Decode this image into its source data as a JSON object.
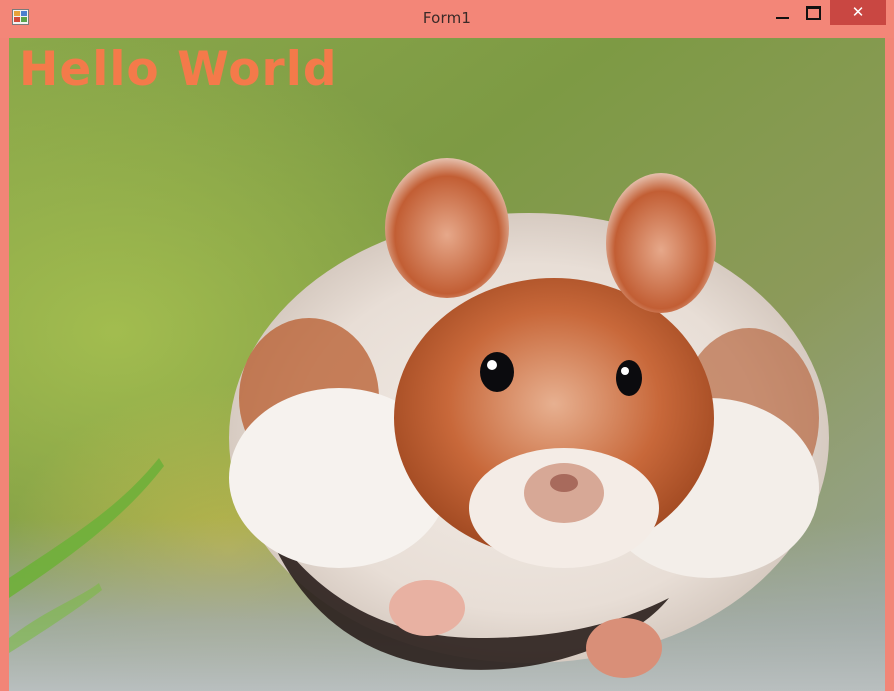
{
  "window": {
    "title": "Form1",
    "icon": "windows-forms-app-icon",
    "controls": {
      "minimize": "minimize-icon",
      "maximize": "maximize-icon",
      "close_glyph": "✕"
    },
    "frame_color": "#f38678",
    "close_color": "#c94742"
  },
  "content": {
    "label_text": "Hello World",
    "label_color": "#f47a4a",
    "background_image": "hamster-photo"
  }
}
